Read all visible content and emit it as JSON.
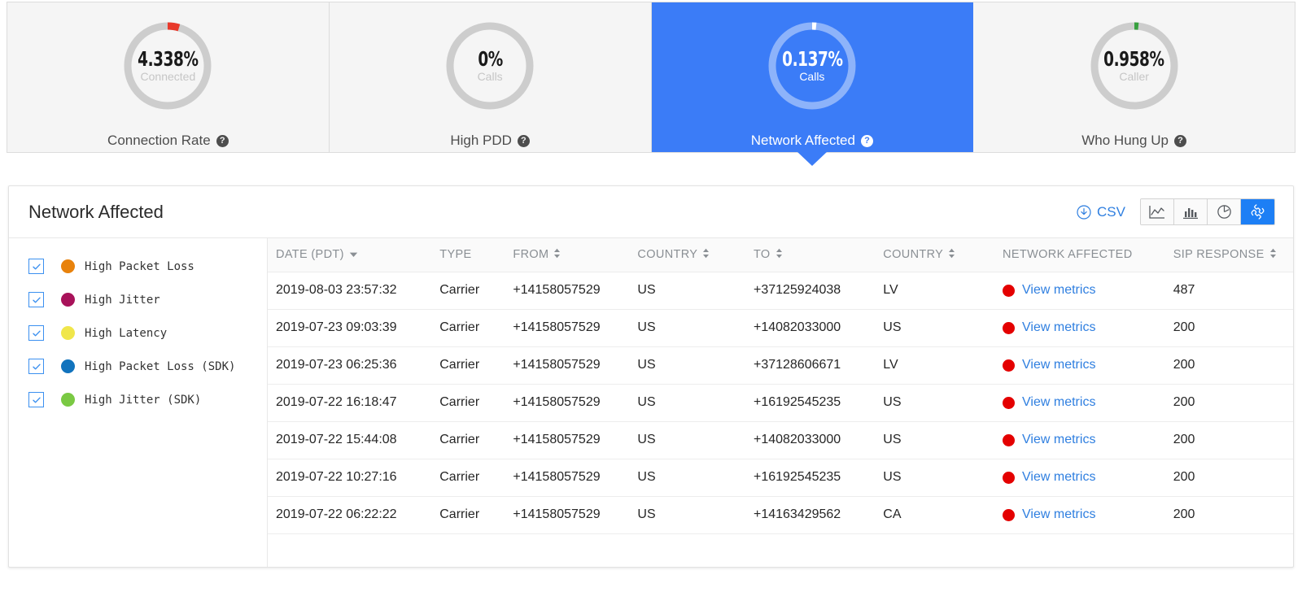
{
  "kpi_cards": [
    {
      "value": "4.338%",
      "sublabel": "Connected",
      "label": "Connection Rate",
      "help": "?",
      "arc_color": "#e8392b",
      "arc_fraction": 0.046,
      "selected": false
    },
    {
      "value": "0%",
      "sublabel": "Calls",
      "label": "High PDD",
      "help": "?",
      "arc_color": "#cccccc",
      "arc_fraction": 0,
      "selected": false
    },
    {
      "value": "0.137%",
      "sublabel": "Calls",
      "label": "Network Affected",
      "help": "?",
      "arc_color": "#ffffff",
      "arc_fraction": 0.0137,
      "selected": true
    },
    {
      "value": "0.958%",
      "sublabel": "Caller",
      "label": "Who Hung Up",
      "help": "?",
      "arc_color": "#37a03f",
      "arc_fraction": 0.0096,
      "selected": false
    }
  ],
  "panel": {
    "title": "Network Affected",
    "csv_label": "CSV",
    "view_buttons": [
      {
        "name": "line-chart-view",
        "active": false
      },
      {
        "name": "bar-chart-view",
        "active": false
      },
      {
        "name": "pie-chart-view",
        "active": false
      },
      {
        "name": "call-log-view",
        "active": true
      }
    ]
  },
  "legend": [
    {
      "label": "High Packet Loss",
      "color": "#e8820c",
      "checked": true
    },
    {
      "label": "High Jitter",
      "color": "#a8125a",
      "checked": true
    },
    {
      "label": "High Latency",
      "color": "#f0e64b",
      "checked": true
    },
    {
      "label": "High Packet Loss (SDK)",
      "color": "#1173bd",
      "checked": true
    },
    {
      "label": "High Jitter (SDK)",
      "color": "#7ac943",
      "checked": true
    }
  ],
  "table": {
    "columns": [
      {
        "label": "DATE (PDT)",
        "sort": "down"
      },
      {
        "label": "TYPE",
        "sort": "none"
      },
      {
        "label": "FROM",
        "sort": "both"
      },
      {
        "label": "COUNTRY",
        "sort": "both"
      },
      {
        "label": "TO",
        "sort": "both"
      },
      {
        "label": "COUNTRY",
        "sort": "both"
      },
      {
        "label": "NETWORK AFFECTED",
        "sort": "none"
      },
      {
        "label": "SIP RESPONSE",
        "sort": "both"
      }
    ],
    "metrics_link_label": "View metrics",
    "metrics_dot_color": "#e40000",
    "rows": [
      {
        "date": "2019-08-03 23:57:32",
        "type": "Carrier",
        "from": "+14158057529",
        "from_country": "US",
        "to": "+37125924038",
        "to_country": "LV",
        "sip": "487"
      },
      {
        "date": "2019-07-23 09:03:39",
        "type": "Carrier",
        "from": "+14158057529",
        "from_country": "US",
        "to": "+14082033000",
        "to_country": "US",
        "sip": "200"
      },
      {
        "date": "2019-07-23 06:25:36",
        "type": "Carrier",
        "from": "+14158057529",
        "from_country": "US",
        "to": "+37128606671",
        "to_country": "LV",
        "sip": "200"
      },
      {
        "date": "2019-07-22 16:18:47",
        "type": "Carrier",
        "from": "+14158057529",
        "from_country": "US",
        "to": "+16192545235",
        "to_country": "US",
        "sip": "200"
      },
      {
        "date": "2019-07-22 15:44:08",
        "type": "Carrier",
        "from": "+14158057529",
        "from_country": "US",
        "to": "+14082033000",
        "to_country": "US",
        "sip": "200"
      },
      {
        "date": "2019-07-22 10:27:16",
        "type": "Carrier",
        "from": "+14158057529",
        "from_country": "US",
        "to": "+16192545235",
        "to_country": "US",
        "sip": "200"
      },
      {
        "date": "2019-07-22 06:22:22",
        "type": "Carrier",
        "from": "+14158057529",
        "from_country": "US",
        "to": "+14163429562",
        "to_country": "CA",
        "sip": "200"
      }
    ]
  },
  "colors": {
    "accent_blue": "#3b7cf7",
    "link_blue": "#2f7fe0",
    "date_red": "#f0434f",
    "active_button_blue": "#1d7ff5"
  }
}
